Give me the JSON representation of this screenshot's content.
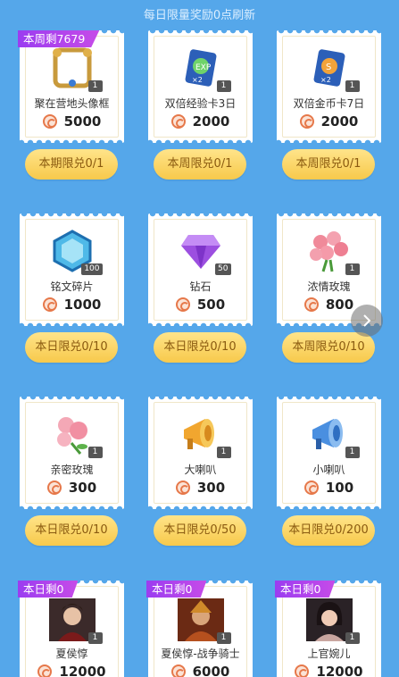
{
  "notice": "每日限量奖励0点刷新",
  "next_icon": "chevron-right-icon",
  "rows": [
    {
      "items": [
        {
          "badge": "本周剩7679",
          "name": "聚在营地头像框",
          "price": "5000",
          "qty": "1",
          "icon": "avatar-frame-icon",
          "limit": "本期限兑0/1"
        },
        {
          "badge": "",
          "name": "双倍经验卡3日",
          "price": "2000",
          "qty": "1",
          "icon": "exp-card-icon",
          "limit": "本周限兑0/1"
        },
        {
          "badge": "",
          "name": "双倍金币卡7日",
          "price": "2000",
          "qty": "1",
          "icon": "gold-card-icon",
          "limit": "本周限兑0/1"
        }
      ]
    },
    {
      "items": [
        {
          "badge": "",
          "name": "铭文碎片",
          "price": "1000",
          "qty": "100",
          "icon": "inscription-shard-icon",
          "limit": "本日限兑0/10"
        },
        {
          "badge": "",
          "name": "钻石",
          "price": "500",
          "qty": "50",
          "icon": "diamond-icon",
          "limit": "本日限兑0/10"
        },
        {
          "badge": "",
          "name": "浓情玫瑰",
          "price": "800",
          "qty": "1",
          "icon": "rose-bouquet-icon",
          "limit": "本周限兑0/10"
        }
      ]
    },
    {
      "items": [
        {
          "badge": "",
          "name": "亲密玫瑰",
          "price": "300",
          "qty": "1",
          "icon": "rose-icon",
          "limit": "本日限兑0/10"
        },
        {
          "badge": "",
          "name": "大喇叭",
          "price": "300",
          "qty": "1",
          "icon": "big-horn-icon",
          "limit": "本日限兑0/50"
        },
        {
          "badge": "",
          "name": "小喇叭",
          "price": "100",
          "qty": "1",
          "icon": "small-horn-icon",
          "limit": "本日限兑0/200"
        }
      ]
    },
    {
      "items": [
        {
          "badge": "本日剩0",
          "name": "夏侯惇",
          "price": "12000",
          "qty": "1",
          "icon": "hero-portrait-icon",
          "limit": ""
        },
        {
          "badge": "本日剩0",
          "name": "夏侯惇-战争骑士",
          "price": "6000",
          "qty": "1",
          "icon": "skin-portrait-icon",
          "limit": ""
        },
        {
          "badge": "本日剩0",
          "name": "上官婉儿",
          "price": "12000",
          "qty": "1",
          "icon": "hero-portrait-icon",
          "limit": ""
        }
      ]
    }
  ],
  "colors": {
    "background": "#55a7ea",
    "ribbon": "#a93ff0",
    "button": "#f9d15c",
    "button_text": "#8a5a10"
  }
}
